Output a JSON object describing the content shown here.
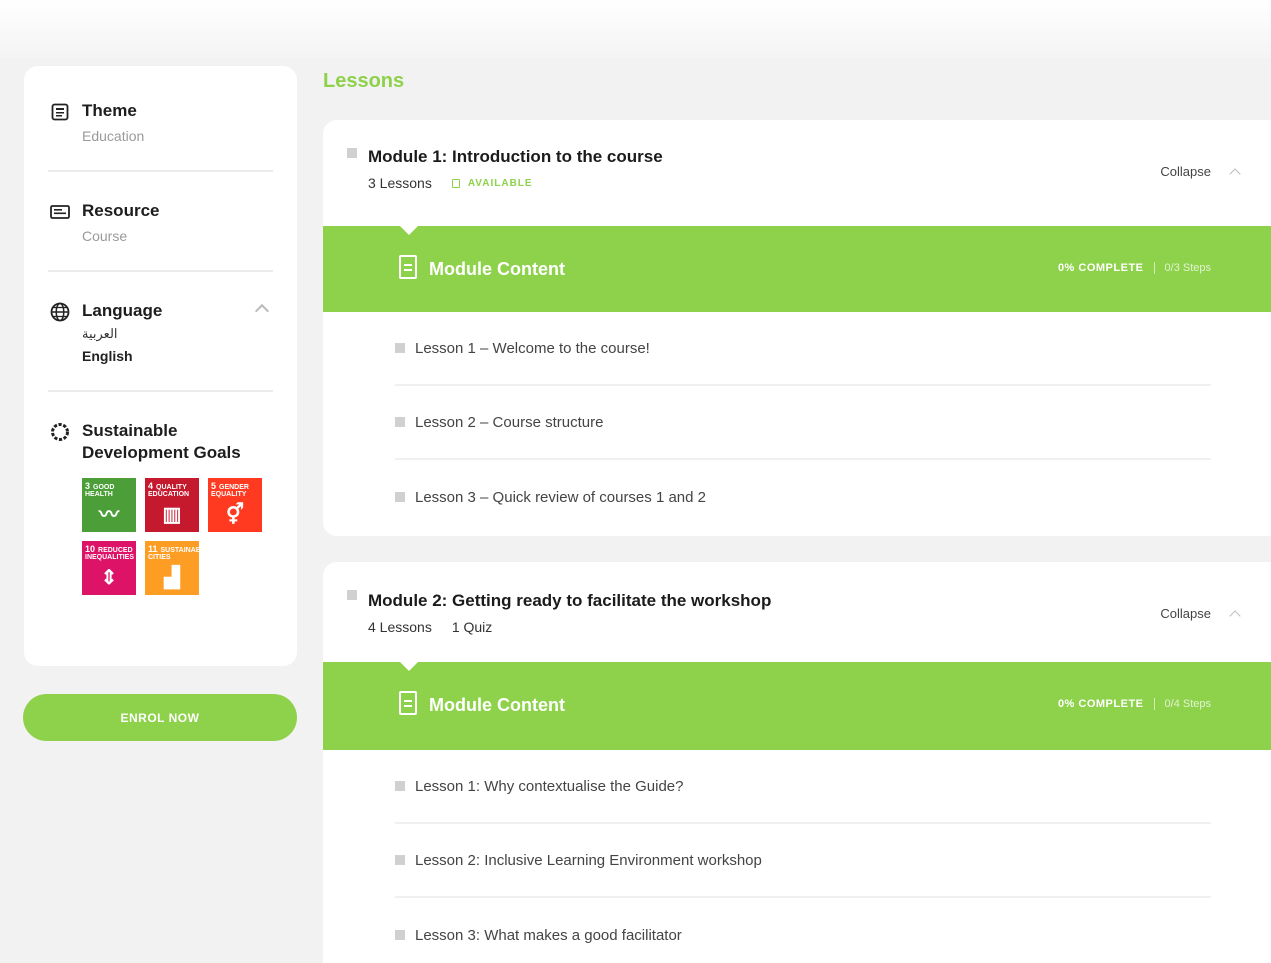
{
  "sidebar": {
    "theme": {
      "label": "Theme",
      "value": "Education"
    },
    "resource": {
      "label": "Resource",
      "value": "Course"
    },
    "language": {
      "label": "Language",
      "options": [
        "العربية",
        "English"
      ],
      "selected": "English"
    },
    "sdg": {
      "label": "Sustainable Development Goals",
      "goals": [
        {
          "num": "3",
          "name": "GOOD HEALTH",
          "color": "#4c9f38",
          "glyph": "〰"
        },
        {
          "num": "4",
          "name": "QUALITY EDUCATION",
          "color": "#c5192d",
          "glyph": "▥"
        },
        {
          "num": "5",
          "name": "GENDER EQUALITY",
          "color": "#ff3a21",
          "glyph": "⚥"
        },
        {
          "num": "10",
          "name": "REDUCED INEQUALITIES",
          "color": "#dd1367",
          "glyph": "⇕"
        },
        {
          "num": "11",
          "name": "SUSTAINABLE CITIES",
          "color": "#fd9d24",
          "glyph": "▟"
        }
      ]
    },
    "enrol_label": "ENROL NOW"
  },
  "main": {
    "title": "Lessons",
    "modules": [
      {
        "title": "Module 1: Introduction to the course",
        "meta_lessons": "3 Lessons",
        "meta_extra": "AVAILABLE",
        "collapse_label": "Collapse",
        "content_label": "Module Content",
        "progress": "0% COMPLETE",
        "steps": "0/3 Steps",
        "lessons": [
          "Lesson 1 – Welcome to the course!",
          "Lesson 2 – Course structure",
          "Lesson 3 – Quick review of courses 1 and 2"
        ]
      },
      {
        "title": "Module 2: Getting ready to facilitate the workshop",
        "meta_lessons": "4 Lessons",
        "meta_extra": "1 Quiz",
        "collapse_label": "Collapse",
        "content_label": "Module Content",
        "progress": "0% COMPLETE",
        "steps": "0/4 Steps",
        "lessons": [
          "Lesson 1: Why contextualise the Guide?",
          "Lesson 2: Inclusive Learning Environment workshop",
          "Lesson 3: What makes a good facilitator"
        ]
      }
    ]
  },
  "colors": {
    "accent": "#8ed14b",
    "background": "#f2f2f2"
  }
}
